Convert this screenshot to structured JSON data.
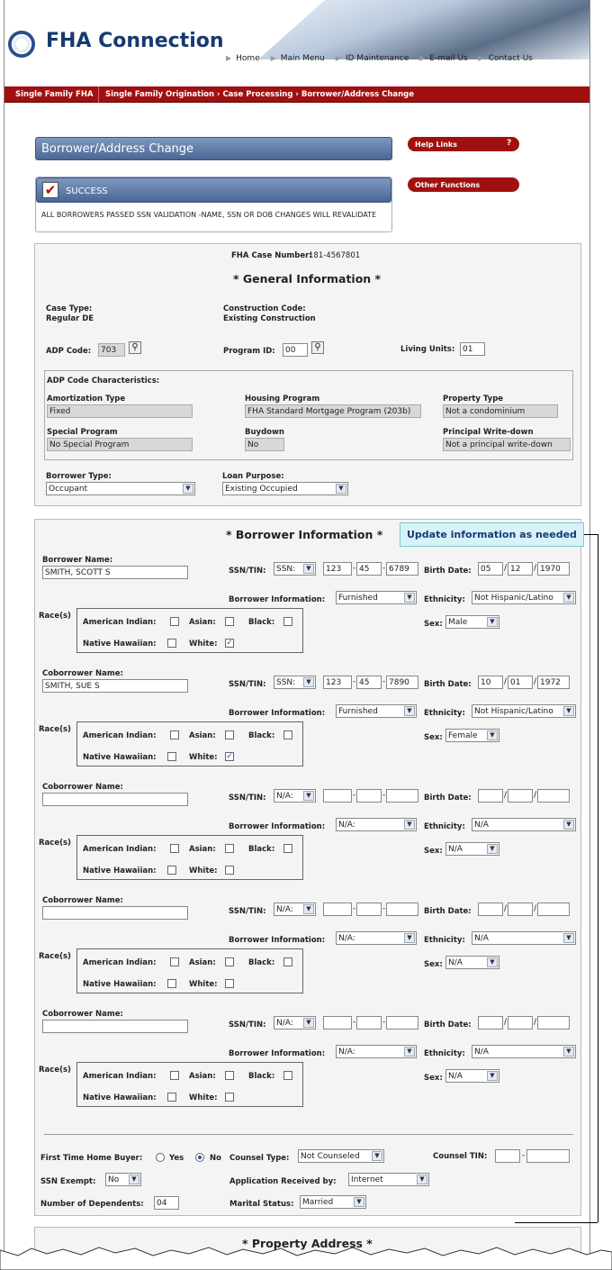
{
  "header": {
    "app_title": "FHA Connection",
    "nav": [
      "Home",
      "Main Menu",
      "ID Maintenance",
      "E-mail Us",
      "Contact Us"
    ]
  },
  "breadcrumb": {
    "root": "Single Family FHA",
    "path": "Single Family Origination › Case Processing › Borrower/Address Change"
  },
  "page_title": "Borrower/Address Change",
  "success": {
    "label": "SUCCESS",
    "message": "ALL BORROWERS PASSED SSN VALIDATION -NAME, SSN OR DOB CHANGES WILL REVALIDATE"
  },
  "side_links": {
    "help_links": "Help Links",
    "help_q": "?",
    "other_functions": "Other Functions"
  },
  "general": {
    "case_number_label": "FHA Case Number:",
    "case_number": "181-4567801",
    "heading": "* General Information *",
    "case_type_label": "Case Type:",
    "case_type": "Regular DE",
    "construction_code_label": "Construction Code:",
    "construction_code": "Existing Construction",
    "adp_code_label": "ADP Code:",
    "adp_code": "703",
    "program_id_label": "Program ID:",
    "program_id": "00",
    "living_units_label": "Living Units:",
    "living_units": "01",
    "adp_char_label": "ADP Code Characteristics:",
    "amortization_label": "Amortization Type",
    "amortization": "Fixed",
    "housing_program_label": "Housing Program",
    "housing_program": "FHA Standard Mortgage Program (203b)",
    "property_type_label": "Property Type",
    "property_type": "Not a condominium",
    "special_program_label": "Special Program",
    "special_program": "No Special Program",
    "buydown_label": "Buydown",
    "buydown": "No",
    "principal_writedown_label": "Principal Write-down",
    "principal_writedown": "Not a principal write-down",
    "borrower_type_label": "Borrower Type:",
    "borrower_type": "Occupant",
    "loan_purpose_label": "Loan Purpose:",
    "loan_purpose": "Existing Occupied"
  },
  "borrower_info": {
    "heading": "* Borrower Information *",
    "tooltip": "Update information as needed",
    "labels": {
      "ssn_tin": "SSN/TIN:",
      "birth_date": "Birth Date:",
      "borrower_information": "Borrower Information:",
      "ethnicity": "Ethnicity:",
      "races": "Race(s)",
      "sex": "Sex:",
      "american_indian": "American Indian:",
      "asian": "Asian:",
      "black": "Black:",
      "native_hawaiian": "Native Hawaiian:",
      "white": "White:"
    },
    "people": [
      {
        "name_label": "Borrower Name:",
        "name": "SMITH, SCOTT S",
        "ssn_type": "SSN:",
        "ssn1": "123",
        "ssn2": "45",
        "ssn3": "6789",
        "dob_m": "05",
        "dob_d": "12",
        "dob_y": "1970",
        "info": "Furnished",
        "ethnicity": "Not Hispanic/Latino",
        "sex": "Male",
        "white": true
      },
      {
        "name_label": "Coborrower Name:",
        "name": "SMITH, SUE S",
        "ssn_type": "SSN:",
        "ssn1": "123",
        "ssn2": "45",
        "ssn3": "7890",
        "dob_m": "10",
        "dob_d": "01",
        "dob_y": "1972",
        "info": "Furnished",
        "ethnicity": "Not Hispanic/Latino",
        "sex": "Female",
        "white": true
      },
      {
        "name_label": "Coborrower Name:",
        "name": "",
        "ssn_type": "N/A:",
        "ssn1": "",
        "ssn2": "",
        "ssn3": "",
        "dob_m": "",
        "dob_d": "",
        "dob_y": "",
        "info": "N/A:",
        "ethnicity": "N/A",
        "sex": "N/A",
        "white": false
      },
      {
        "name_label": "Coborrower Name:",
        "name": "",
        "ssn_type": "N/A:",
        "ssn1": "",
        "ssn2": "",
        "ssn3": "",
        "dob_m": "",
        "dob_d": "",
        "dob_y": "",
        "info": "N/A:",
        "ethnicity": "N/A",
        "sex": "N/A",
        "white": false
      },
      {
        "name_label": "Coborrower Name:",
        "name": "",
        "ssn_type": "N/A:",
        "ssn1": "",
        "ssn2": "",
        "ssn3": "",
        "dob_m": "",
        "dob_d": "",
        "dob_y": "",
        "info": "N/A:",
        "ethnicity": "N/A",
        "sex": "N/A",
        "white": false
      }
    ],
    "first_time_buyer_label": "First Time Home Buyer:",
    "yes_label": "Yes",
    "no_label": "No",
    "first_time_buyer": "No",
    "counsel_type_label": "Counsel Type:",
    "counsel_type": "Not Counseled",
    "counsel_tin_label": "Counsel TIN:",
    "ssn_exempt_label": "SSN Exempt:",
    "ssn_exempt": "No",
    "application_received_label": "Application Received by:",
    "application_received": "Internet",
    "dependents_label": "Number of Dependents:",
    "dependents": "04",
    "marital_status_label": "Marital Status:",
    "marital_status": "Married"
  },
  "property": {
    "heading": "* Property Address *"
  },
  "colors": {
    "brand_red": "#a11010",
    "panel_blue": "#4a6795",
    "title_blue": "#163a70"
  }
}
